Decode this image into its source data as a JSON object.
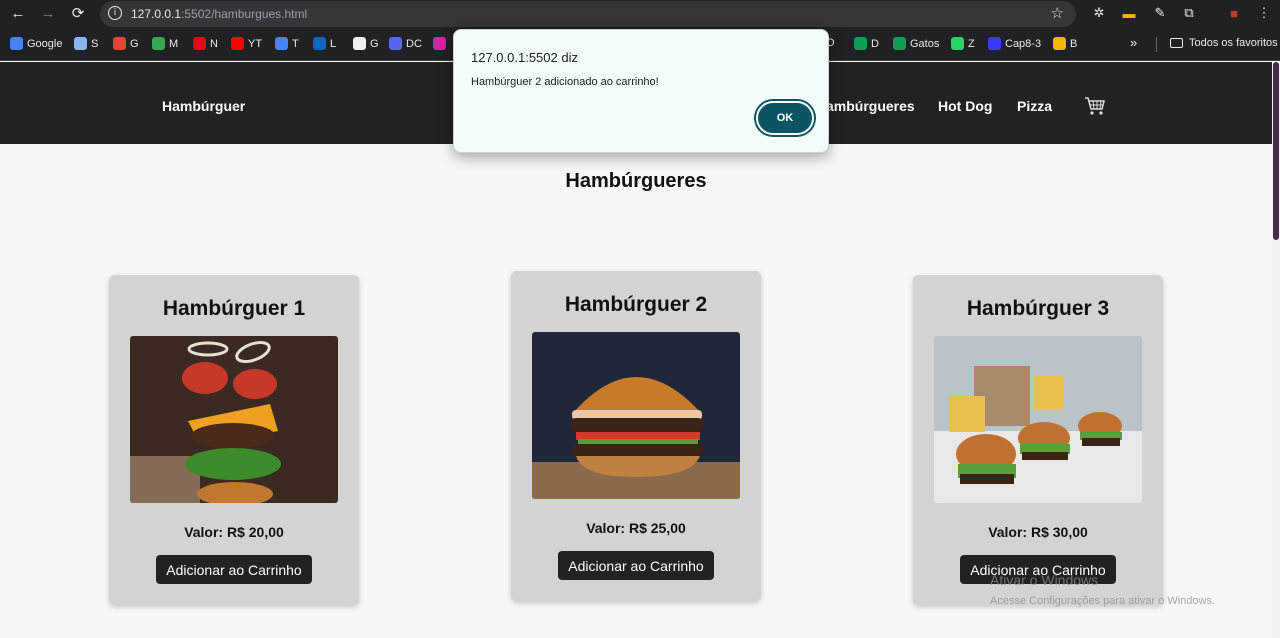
{
  "browser": {
    "url_host": "127.0.0.1",
    "url_rest": ":5502/hamburgues.html",
    "bookmarks": [
      {
        "label": "Google",
        "color": "#4285f4"
      },
      {
        "label": "S",
        "color": "#8ab4f8"
      },
      {
        "label": "G",
        "color": "#ea4335"
      },
      {
        "label": "M",
        "color": "#34a853"
      },
      {
        "label": "N",
        "color": "#e50914"
      },
      {
        "label": "YT",
        "color": "#ff0000"
      },
      {
        "label": "T",
        "color": "#4285f4"
      },
      {
        "label": "L",
        "color": "#0a66c2"
      },
      {
        "label": "G",
        "color": "#f0f0f0"
      },
      {
        "label": "DC",
        "color": "#5865f2"
      },
      {
        "label": "",
        "color": "#d6249f"
      },
      {
        "label": "O",
        "color": "#888888"
      },
      {
        "label": "D",
        "color": "#0f9d58"
      },
      {
        "label": "Gatos",
        "color": "#0f9d58"
      },
      {
        "label": "Z",
        "color": "#25d366"
      },
      {
        "label": "Cap8-3",
        "color": "#3b3bff"
      },
      {
        "label": "B",
        "color": "#f4b400"
      }
    ],
    "all_bookmarks_label": "Todos os favoritos"
  },
  "site": {
    "brand": "Hambúrguer",
    "nav": [
      "ambúrgueres",
      "Hot Dog",
      "Pizza"
    ],
    "page_title": "Hambúrgueres",
    "products": [
      {
        "name": "Hambúrguer 1",
        "price": "Valor: R$ 20,00",
        "button": "Adicionar ao Carrinho"
      },
      {
        "name": "Hambúrguer 2",
        "price": "Valor: R$ 25,00",
        "button": "Adicionar ao Carrinho"
      },
      {
        "name": "Hambúrguer 3",
        "price": "Valor: R$ 30,00",
        "button": "Adicionar ao Carrinho"
      }
    ]
  },
  "dialog": {
    "title": "127.0.0.1:5502 diz",
    "message": "Hambúrguer 2 adicionado ao carrinho!",
    "ok_label": "OK"
  },
  "watermark": {
    "line1": "Ativar o Windows",
    "line2": "Acesse Configurações para ativar o Windows."
  }
}
